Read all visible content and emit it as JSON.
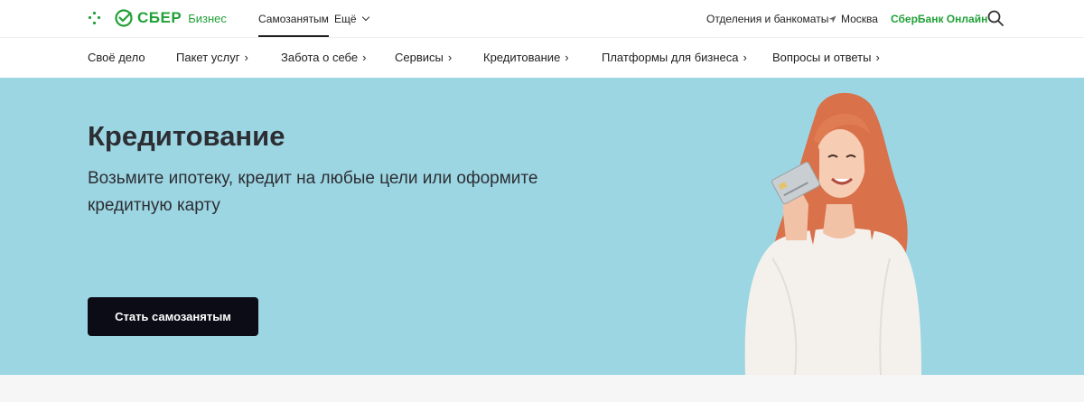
{
  "header": {
    "logo_text": "СБЕР",
    "logo_sub": "Бизнес",
    "tabs": [
      {
        "label": "Самозанятым",
        "active": true
      },
      {
        "label": "Ещё"
      }
    ],
    "branches_link": "Отделения и банкоматы",
    "city": "Москва",
    "online_link": "СберБанк Онлайн",
    "icons": [
      "apps-icon",
      "sber-logo-icon",
      "location-icon",
      "search-icon",
      "chevron-down-icon"
    ],
    "accent_color": "#21a038"
  },
  "subnav": {
    "items": [
      {
        "label": "Своё дело",
        "arrow": ""
      },
      {
        "label": "Пакет услуг",
        "arrow": "›"
      },
      {
        "label": "Забота о себе",
        "arrow": "›"
      },
      {
        "label": "Сервисы",
        "arrow": "›"
      },
      {
        "label": "Кредитование",
        "arrow": "›"
      },
      {
        "label": "Платформы для бизнеса",
        "arrow": "›"
      },
      {
        "label": "Вопросы и ответы",
        "arrow": "›"
      }
    ]
  },
  "hero": {
    "title": "Кредитование",
    "subtitle": "Возьмите ипотеку, кредит на любые цели или оформите кредитную карту",
    "cta_label": "Стать самозанятым",
    "background_color": "#9dd6e3"
  }
}
